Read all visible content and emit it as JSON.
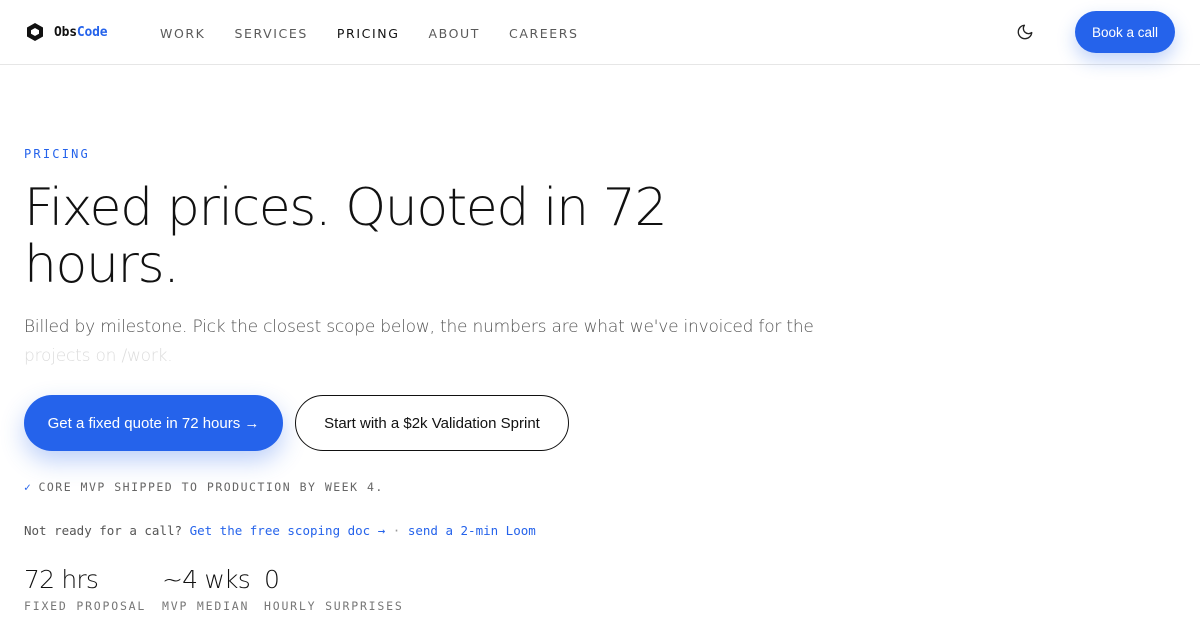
{
  "header": {
    "logo": {
      "part1": "Obs",
      "part2": "Code",
      "icon": "hexagon-logo-icon"
    },
    "nav": [
      {
        "label": "WORK",
        "active": false
      },
      {
        "label": "SERVICES",
        "active": false
      },
      {
        "label": "PRICING",
        "active": true
      },
      {
        "label": "ABOUT",
        "active": false
      },
      {
        "label": "CAREERS",
        "active": false
      }
    ],
    "theme_toggle_icon": "moon-icon",
    "book_call_label": "Book a call"
  },
  "hero": {
    "eyebrow": "PRICING",
    "headline": "Fixed prices. Quoted in 72 hours.",
    "subtitle_main": "Billed by milestone. Pick the closest scope below, the numbers are what we've invoiced for the",
    "subtitle_faded": "projects on /work.",
    "cta_primary": "Get a fixed quote in 72 hours →",
    "cta_secondary": "Start with a $2k Validation Sprint",
    "guarantee_check": "✓",
    "guarantee": "CORE MVP SHIPPED TO PRODUCTION BY WEEK 4.",
    "not_ready_prefix": "Not ready for a call?",
    "scoping_link": "Get the free scoping doc →",
    "separator": "·",
    "loom_link": "send a 2-min Loom"
  },
  "stats": [
    {
      "value": "72 hrs",
      "label": "FIXED PROPOSAL"
    },
    {
      "value": "~4 wks",
      "label": "MVP MEDIAN"
    },
    {
      "value": "0",
      "label": "HOURLY SURPRISES"
    }
  ],
  "colors": {
    "accent": "#2563eb",
    "text": "#111111",
    "muted": "#555555"
  }
}
